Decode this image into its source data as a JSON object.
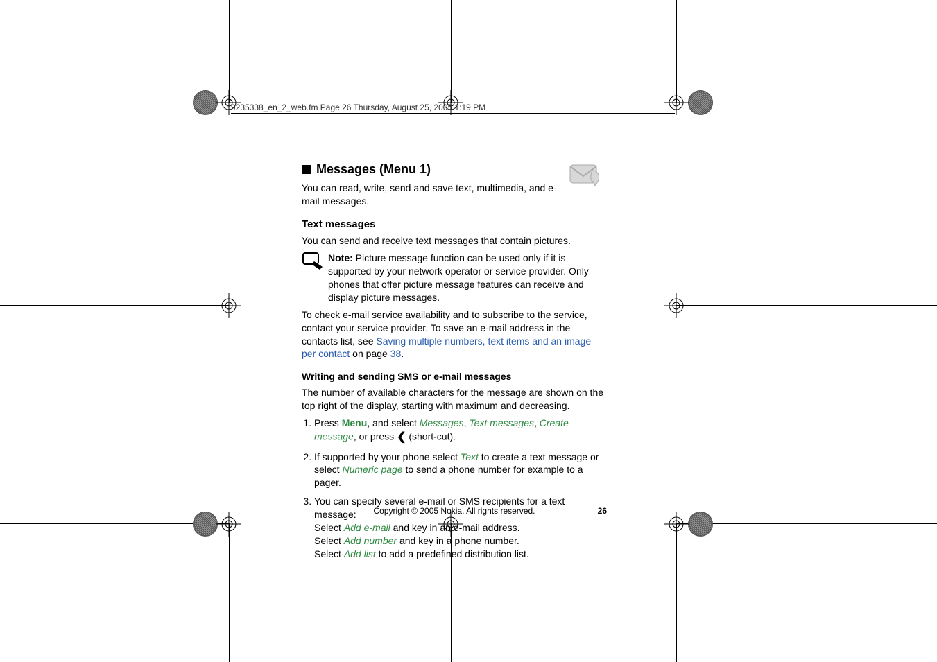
{
  "header": {
    "strip": "9235338_en_2_web.fm  Page 26  Thursday, August 25, 2005  1:19 PM"
  },
  "icons": {
    "envelope": "messages-envelope-icon",
    "note": "note-hand-icon",
    "left_arrow": "❮"
  },
  "content": {
    "h1": "Messages (Menu 1)",
    "h1_desc": "You can read, write, send and save text, multimedia, and e-mail messages.",
    "sub1": "Text messages",
    "sub1_p": "You can send and receive text messages that contain pictures.",
    "note_label": "Note:",
    "note_body": " Picture message function can be used only if it is supported by your network operator or service provider. Only phones that offer picture message features can receive and display picture messages.",
    "para2_a": "To check e-mail service availability and to subscribe to the service, contact your service provider. To save an e-mail address in the contacts list, see ",
    "para2_link": "Saving multiple numbers, text items and an image per contact",
    "para2_b": " on page ",
    "para2_page": "38",
    "para2_c": ".",
    "sub2": "Writing and sending SMS or e-mail messages",
    "sub2_p": "The number of available characters for the message are shown on the top right of the display, starting with maximum and decreasing.",
    "list": {
      "i1": {
        "a": "Press ",
        "menu": "Menu",
        "b": ", and select ",
        "m1": "Messages",
        "c": ", ",
        "m2": "Text messages",
        "d": ", ",
        "m3": "Create message",
        "e": ", or press ",
        "f": " (short-cut)."
      },
      "i2": {
        "a": "If supported by your phone select ",
        "m1": "Text",
        "b": " to create a text message or select ",
        "m2": "Numeric page",
        "c": " to send a phone number for example to a pager."
      },
      "i3": {
        "a": "You can specify several e-mail or SMS recipients for a text message:",
        "l1a": "Select ",
        "l1m": "Add e-mail",
        "l1b": " and key in an e-mail address.",
        "l2a": "Select ",
        "l2m": "Add number",
        "l2b": " and key in a phone number.",
        "l3a": "Select ",
        "l3m": "Add list",
        "l3b": " to add a predefined distribution list."
      }
    }
  },
  "footer": {
    "copyright": "Copyright © 2005 Nokia. All rights reserved.",
    "page": "26"
  }
}
